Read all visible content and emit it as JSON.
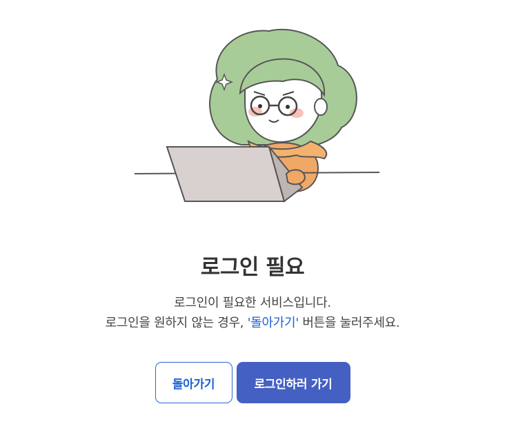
{
  "login_required": {
    "title": "로그인 필요",
    "line1": "로그인이 필요한 서비스입니다.",
    "line2_before": "로그인을 원하지 않는 경우, ",
    "line2_highlight": "'돌아가기'",
    "line2_after": " 버튼을 눌러주세요."
  },
  "actions": {
    "back_label": "돌아가기",
    "login_label": "로그인하러 가기"
  },
  "colors": {
    "accent": "#1a5fd6",
    "primary_button": "#4460c2",
    "hair": "#a8cc98",
    "sweater": "#f0a867",
    "laptop": "#d9d1cf"
  },
  "illustration": {
    "icon": "person-with-laptop-icon"
  }
}
